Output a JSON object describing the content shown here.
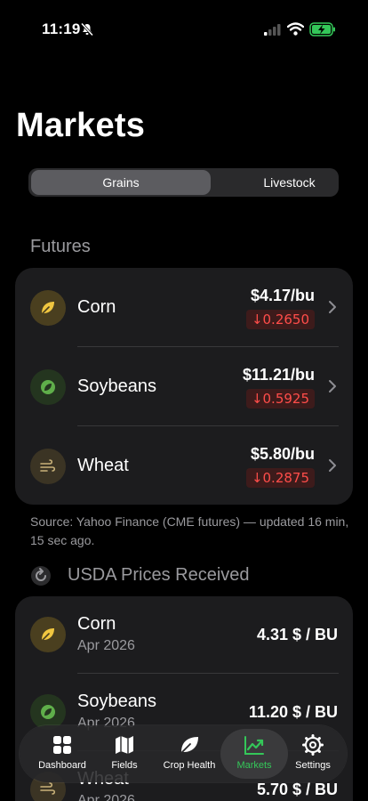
{
  "status": {
    "time": "11:19"
  },
  "title": "Markets",
  "segments": {
    "grains": "Grains",
    "livestock": "Livestock"
  },
  "futures": {
    "label": "Futures",
    "items": [
      {
        "name": "Corn",
        "price": "$4.17/bu",
        "change": "↓0.2650",
        "icon": "leaf-icon"
      },
      {
        "name": "Soybeans",
        "price": "$11.21/bu",
        "change": "↓0.5925",
        "icon": "leaf-circle-icon"
      },
      {
        "name": "Wheat",
        "price": "$5.80/bu",
        "change": "↓0.2875",
        "icon": "wind-icon"
      }
    ],
    "source": "Source: Yahoo Finance (CME futures) — updated 16 min, 15 sec ago."
  },
  "usda": {
    "label": "USDA Prices Received",
    "items": [
      {
        "name": "Corn",
        "date": "Apr 2026",
        "price": "4.31 $ / BU"
      },
      {
        "name": "Soybeans",
        "date": "Apr 2026",
        "price": "11.20 $ / BU"
      },
      {
        "name": "Wheat",
        "date": "Apr 2026",
        "price": "5.70 $ / BU"
      }
    ]
  },
  "tabs": {
    "dashboard": "Dashboard",
    "fields": "Fields",
    "crop_health": "Crop Health",
    "markets": "Markets",
    "settings": "Settings"
  },
  "colors": {
    "accent": "#34c759",
    "negative": "#ff4d4a",
    "card": "#1c1c1e"
  }
}
